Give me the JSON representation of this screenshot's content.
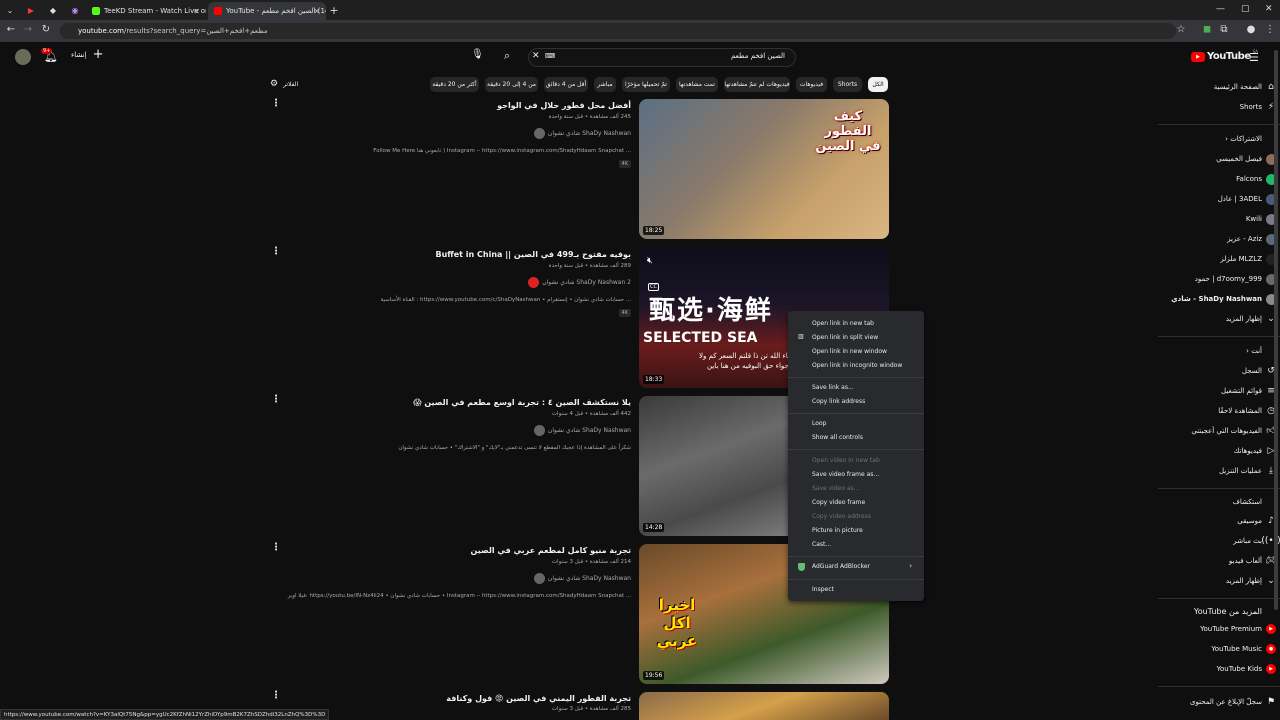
{
  "browser": {
    "tabs": [
      {
        "title": "TeeKD Stream - Watch Live on",
        "fav_color": "#53fc18"
      },
      {
        "title": "(14) الصين افخم مطعم - YouTube",
        "fav_color": "#ff0000"
      }
    ],
    "url_host": "youtube.com",
    "url_rest": "/results?search_query=مطعم+افخم+الصين"
  },
  "youtube": {
    "logo_text": "YouTube",
    "logo_region": "SA",
    "search_value": "الصين افخم مطعم",
    "create_label": "إنشاء",
    "notif_count": "9+",
    "filters_label": "الفلاتر",
    "chips": [
      "الكل",
      "Shorts",
      "فيديوهات",
      "فيديوهات لم تتمّ مشاهدتها",
      "تمت مشاهدتها",
      "تمّ تحميلها مؤخرًا",
      "مباشر",
      "أقل من 4 دقائق",
      "من 4 إلى 20 دقيقة",
      "أكثر من 20 دقيقة"
    ]
  },
  "sidebar": {
    "home": "الصفحة الرئيسية",
    "shorts": "Shorts",
    "subs_header": "الاشتراكات",
    "subs": [
      "فيصل الخميسي",
      "Falcons",
      "3ADEL | عادل",
      "Kwili",
      "Aziz - عزيز",
      "MLZLZ ملزلز",
      "d7oomy_999 | حمود",
      "ShaDy Nashwan - شادي",
      "إظهار المزيد"
    ],
    "you_header": "أنت",
    "you": [
      "السجل",
      "قوائم التشغيل",
      "المشاهدة لاحقًا",
      "الفيديوهات التي أعجبتني",
      "فيديوهاتك",
      "عمليات التنزيل"
    ],
    "explore_header": "استكشاف",
    "explore": [
      "موسيقى",
      "بث مباشر",
      "ألعاب فيديو",
      "إظهار المزيد"
    ],
    "more_header": "المزيد من YouTube",
    "more": [
      "YouTube Premium",
      "YouTube Music",
      "YouTube Kids"
    ],
    "report": "سجلّ الإبلاغ عن المحتوى"
  },
  "results": [
    {
      "title": "أفضل محل فطور حلال في الواجو",
      "meta": "245 ألف مشاهدة • قبل سنة واحدة",
      "channel": "ShaDy Nashwan شادي نشوان",
      "desc": "Follow Me Here تابعوني هنا ) Instagram ‒ https://www.instagram.com/ShadyHdaam Snapchat ...",
      "badge": "4K",
      "duration": "18:25"
    },
    {
      "title": "بوفيه مفتوح بـ499 في الصين || Buffet in China",
      "meta": "289 ألف مشاهدة • قبل سنة واحدة",
      "channel": "ShaDy Nashwan 2 شادي نشوان",
      "desc": "القناة الأساسية : https://www.youtube.com/c/ShaDyNashwan • حسابات شادي نشوان • إنستقرام ...",
      "badge": "4K",
      "duration": "18:33"
    },
    {
      "title": "يلا نستكشف الصين ٤ : تجربة اوسع مطعم في الصين 😱",
      "meta": "442 ألف مشاهدة • قبل 4 سنوات",
      "channel": "ShaDy Nashwan شادي نشوان",
      "desc": "شكراً على المشاهدة إذا عجبك المقطع لا تنسى تدعمني بـ\"لايك\" و \"الاشتراك\" • حسابات شادي نشوان",
      "badge": "",
      "duration": "14:28"
    },
    {
      "title": "تجربة منيو كامل لمطعم عربي في الصين",
      "meta": "214 ألف مشاهدة • قبل 3 سنوات",
      "channel": "ShaDy Nashwan شادي نشوان",
      "desc": "فيلا اوير: https://youtu.be/IN-Nz4li24 • حسابات شادي نشوان • Instagram ‒ https://www.instagram.com/ShadyHdaam Snapchat ...",
      "badge": "",
      "duration": "19:56"
    },
    {
      "title": "تجربة الفطور اليمني في الصين 😡 فول وكنافة",
      "meta": "285 ألف مشاهدة • قبل 3 سنوات",
      "channel": "",
      "desc": "",
      "badge": "",
      "duration": ""
    }
  ],
  "thumb_text": {
    "r1_overlay": "كيف الفطور في الصين",
    "r2_overlay_cn": "甄选·海鲜",
    "r2_overlay_en": "SELECTED SEA",
    "r2_overlay_ar": "ما شاء الله تن ذا قلتم السعر كم ولا",
    "r2_overlay_ar2": "نوية الاجواء حق البوفيه من هنا باين",
    "r4_overlay": "اخيرا اكل عربي"
  },
  "context_menu": {
    "group1": [
      "Open link in new tab",
      "Open link in split view",
      "Open link in new window",
      "Open link in incognito window"
    ],
    "group2": [
      "Save link as...",
      "Copy link address"
    ],
    "group3": [
      "Loop",
      "Show all controls"
    ],
    "group4": [
      {
        "label": "Open video in new tab",
        "disabled": true
      },
      {
        "label": "Save video frame as...",
        "disabled": false
      },
      {
        "label": "Save video as...",
        "disabled": true
      },
      {
        "label": "Copy video frame",
        "disabled": false
      },
      {
        "label": "Copy video address",
        "disabled": true
      },
      {
        "label": "Picture in picture",
        "disabled": false
      },
      {
        "label": "Cast...",
        "disabled": false
      }
    ],
    "extension": "AdGuard AdBlocker",
    "inspect": "Inspect"
  },
  "status_url": "https://www.youtube.com/watch?v=KY3alQt75Ng&pp=ygUc2KfZhNi12YrZhiDYp9mB2K7ZhSDZhdi32LnZhQ%3D%3D",
  "colors": {
    "bg": "#0f0f0f",
    "red": "#ff0000",
    "menu": "#292a2d"
  }
}
